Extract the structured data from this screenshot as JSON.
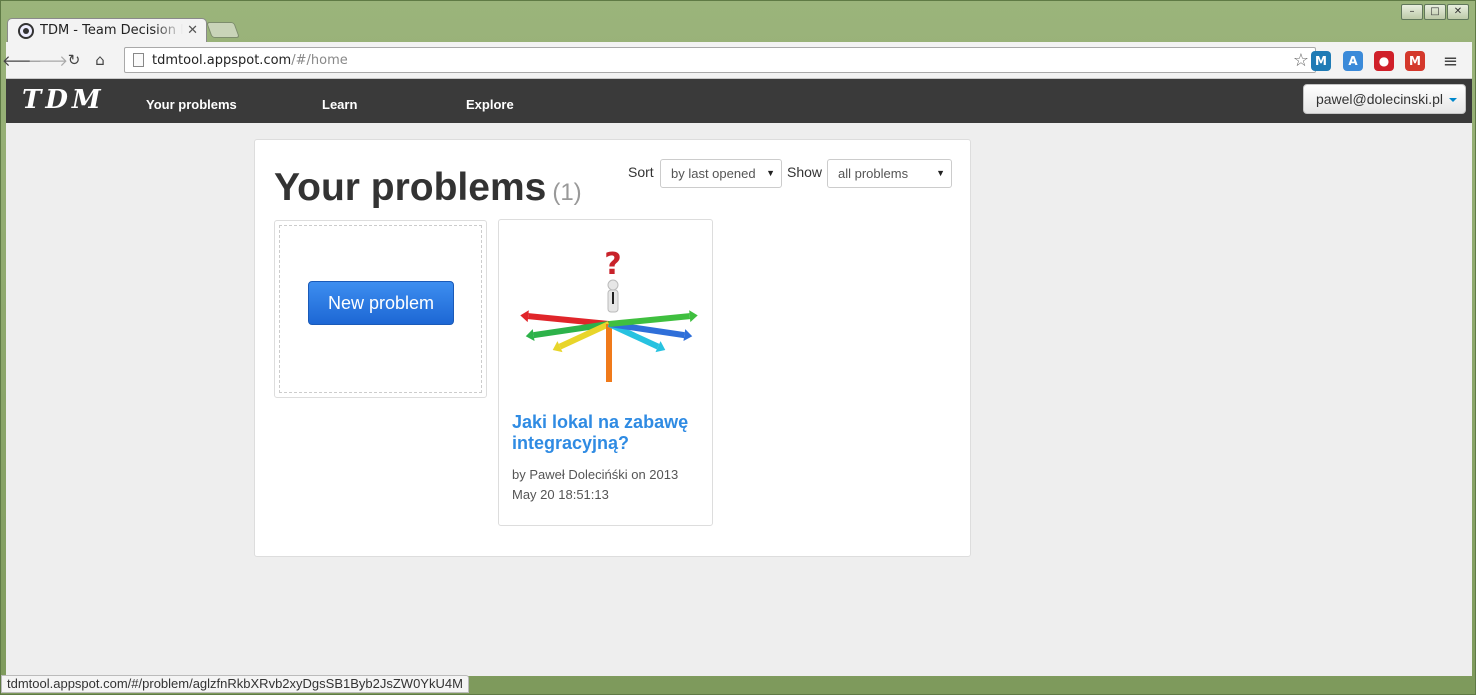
{
  "window": {
    "controls": [
      "–",
      "□",
      "✕"
    ]
  },
  "tab": {
    "title": "TDM - Team Decision Ma",
    "close": "✕"
  },
  "toolbar": {
    "url_host": "tdmtool.appspot.com",
    "url_path": "/#/home",
    "back": "🡐",
    "forward": "🡒",
    "reload": "↻",
    "home": "⌂",
    "star": "☆",
    "menu": "≡"
  },
  "extensions": [
    {
      "name": "mendeley-icon",
      "label": "M",
      "color": "#1f7bb5"
    },
    {
      "name": "translate-icon",
      "label": "A",
      "color": "#3b8ad9"
    },
    {
      "name": "adblock-icon",
      "label": "●",
      "color": "#d0202a"
    },
    {
      "name": "gmail-icon",
      "label": "M",
      "color": "#d4382c"
    }
  ],
  "navbar": {
    "brand": "TDM",
    "links": [
      "Your problems",
      "Learn",
      "Explore"
    ],
    "user": "pawel@dolecinski.pl"
  },
  "panel": {
    "title": "Your problems",
    "count": "(1)",
    "sort_label": "Sort",
    "sort_value": "by last opened",
    "show_label": "Show",
    "show_value": "all problems",
    "new_button": "New problem"
  },
  "problem": {
    "title": "Jaki lokal na zabawę integracyjną?",
    "meta": "by Paweł Dolecińśki on 2013 May 20 18:51:13",
    "arrow_colors": [
      "#e0252a",
      "#2db24a",
      "#e8d52a",
      "#f07a1a",
      "#27c2e0",
      "#2f6fd9",
      "#3fbf3f"
    ]
  },
  "statusbar": {
    "text": "tdmtool.appspot.com/#/problem/aglzfnRkbXRvb2xyDgsSB1Byb2JsZW0YkU4M"
  }
}
